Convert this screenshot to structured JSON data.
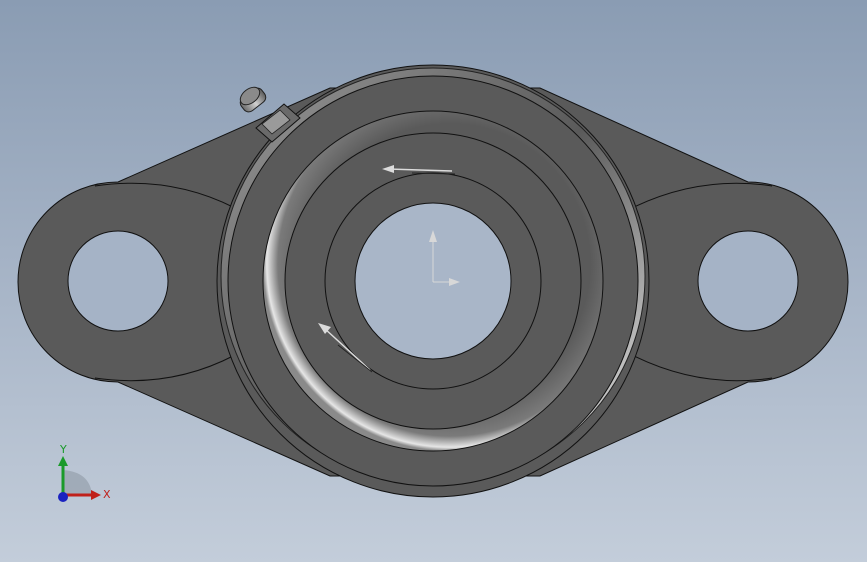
{
  "viewport": {
    "background_top": "#8a9cb3",
    "background_bottom": "#c3cdda"
  },
  "model": {
    "body_color": "#5a5a5a",
    "edge_color": "#111111",
    "highlight_color": "#e8e8e8"
  },
  "triad": {
    "x_label": "X",
    "y_label": "Y",
    "x_color": "#c0201a",
    "y_color": "#1a9a2a",
    "z_color": "#1a22c0"
  }
}
